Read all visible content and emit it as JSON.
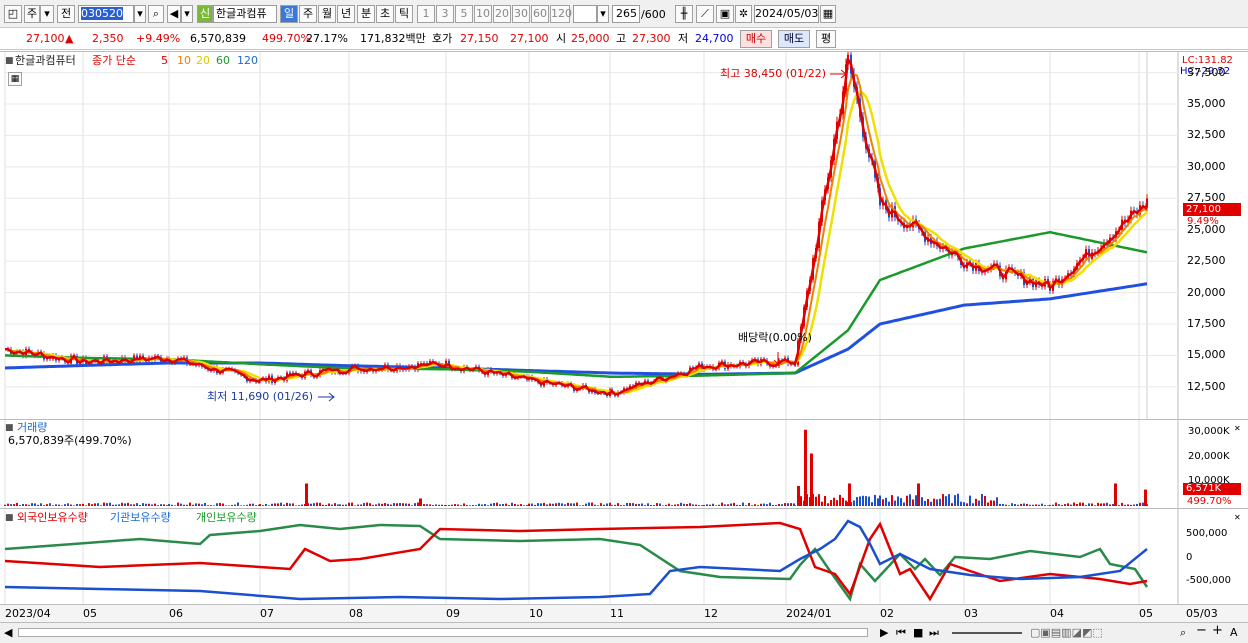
{
  "toolbar": {
    "period_label": "주",
    "adj_label": "전",
    "code": "030520",
    "new_badge": "신",
    "stock_name": "한글과컴퓨",
    "periods": [
      "일",
      "주",
      "월",
      "년",
      "분",
      "초",
      "틱"
    ],
    "minutes": [
      "1",
      "3",
      "5",
      "10",
      "20",
      "30",
      "60",
      "120"
    ],
    "count": "265",
    "count_max": "/600",
    "date": "2024/05/03"
  },
  "info": {
    "price": "27,100",
    "arrow": "▲",
    "change": "2,350",
    "pct": "+9.49%",
    "volume": "6,570,839",
    "vol_pct": "499.70%",
    "turnover": "27.17%",
    "amount": "171,832백만",
    "quote_label": "호가",
    "ask": "27,150",
    "bid": "27,100",
    "open_label": "시",
    "open": "25,000",
    "high_label": "고",
    "high": "27,300",
    "low_label": "저",
    "low": "24,700",
    "buy": "매수",
    "sell": "매도",
    "avg": "평"
  },
  "price_pane": {
    "title": "한글과컴퓨터",
    "ma_label": "종가 단순",
    "ma": [
      "5",
      "10",
      "20",
      "60",
      "120"
    ],
    "lc": "LC:131.82",
    "hc": "HC:-29.52",
    "high_note": "최고 38,450 (01/22)",
    "low_note": "최저 11,690 (01/26)",
    "div_note": "배당락(0.00%)",
    "cur_price": "27,100",
    "cur_pct": "9.49%",
    "yticks": [
      "37,500",
      "35,000",
      "32,500",
      "30,000",
      "27,500",
      "25,000",
      "22,500",
      "20,000",
      "17,500",
      "15,000",
      "12,500"
    ]
  },
  "volume_pane": {
    "title": "거래량",
    "value": "6,570,839주(499.70%)",
    "yticks": [
      "30,000K",
      "20,000K",
      "10,000K"
    ],
    "cur": "6,571K",
    "cur_pct": "499.70%"
  },
  "holder_pane": {
    "s1": "외국인보유수량",
    "s2": "기관보유수량",
    "s3": "개인보유수량",
    "yticks": [
      "500,000",
      "0",
      "-500,000"
    ]
  },
  "xaxis": [
    "2023/04",
    "05",
    "06",
    "07",
    "08",
    "09",
    "10",
    "11",
    "12",
    "2024/01",
    "02",
    "03",
    "04",
    "05",
    "05/03"
  ],
  "colors": {
    "up": "#e00000",
    "down": "#1a4fd0",
    "ma5": "#e00000",
    "ma10": "#f08000",
    "ma20": "#f0e000",
    "ma60": "#1a9a2a",
    "ma120": "#2050e0"
  },
  "chart_data": {
    "type": "line",
    "title": "한글과컴퓨터",
    "price_series": {
      "name": "종가",
      "x": [
        "2023/04",
        "2023/05",
        "2023/06",
        "2023/07",
        "2023/08",
        "2023/09",
        "2023/10",
        "2023/11",
        "2023/12",
        "2024/01",
        "2024/01/22",
        "2024/02",
        "2024/03",
        "2024/04",
        "2024/05/03"
      ],
      "values": [
        15500,
        14500,
        14800,
        13000,
        13900,
        14300,
        13000,
        12000,
        14200,
        14500,
        38450,
        27000,
        22500,
        20500,
        27100
      ]
    },
    "ma60_values": [
      15000,
      14800,
      14700,
      14300,
      14000,
      13900,
      13700,
      13300,
      13400,
      13600,
      17000,
      21000,
      23500,
      24800,
      23200
    ],
    "ma120_values": [
      14000,
      14200,
      14400,
      14400,
      14200,
      14000,
      13800,
      13600,
      13500,
      13600,
      15500,
      17500,
      19000,
      19500,
      20700
    ],
    "ylim": [
      10500,
      38500
    ]
  }
}
